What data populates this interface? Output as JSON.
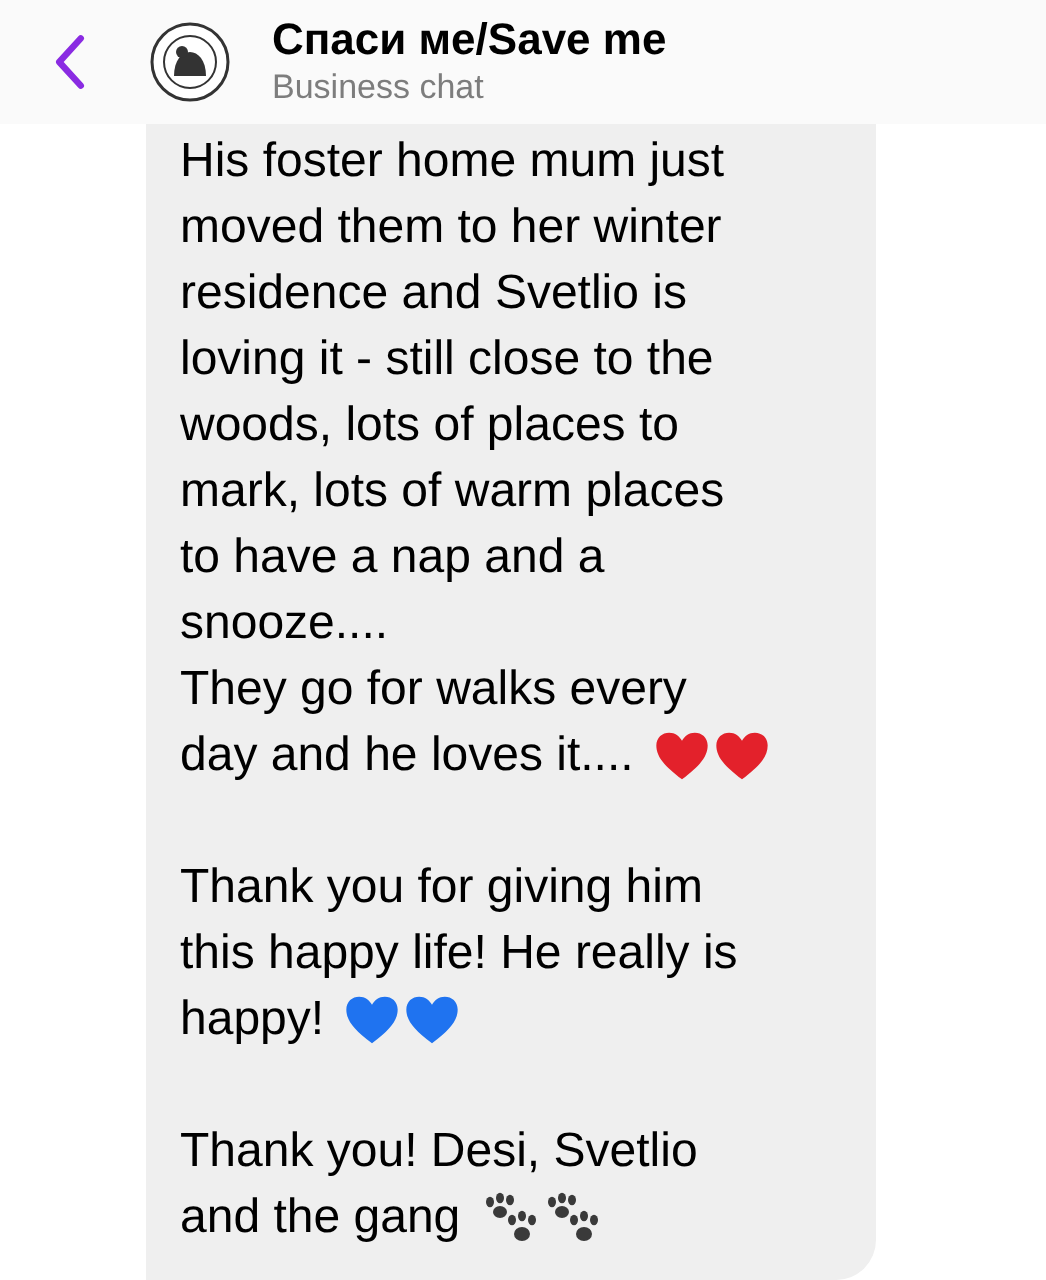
{
  "header": {
    "title": "Спаси ме/Save me",
    "subtitle": "Business chat"
  },
  "message": {
    "paragraphs": [
      {
        "text": "His foster home mum just\nmoved them to her winter\nresidence and Svetlio is\nloving it - still close to the\nwoods, lots of places to\nmark, lots of warm places\nto have a nap and a\nsnooze....\nThey go for walks every\nday and he loves it....",
        "emojis": [
          {
            "kind": "heart",
            "color": "#e3212b"
          },
          {
            "kind": "heart",
            "color": "#e3212b"
          }
        ]
      },
      {
        "text": "Thank you for giving him\nthis happy life! He really is\nhappy!",
        "emojis": [
          {
            "kind": "heart",
            "color": "#1f73f0"
          },
          {
            "kind": "heart",
            "color": "#1f73f0"
          }
        ]
      },
      {
        "text": "Thank you! Desi, Svetlio\nand the gang",
        "emojis": [
          {
            "kind": "paw"
          },
          {
            "kind": "paw"
          }
        ]
      }
    ]
  }
}
